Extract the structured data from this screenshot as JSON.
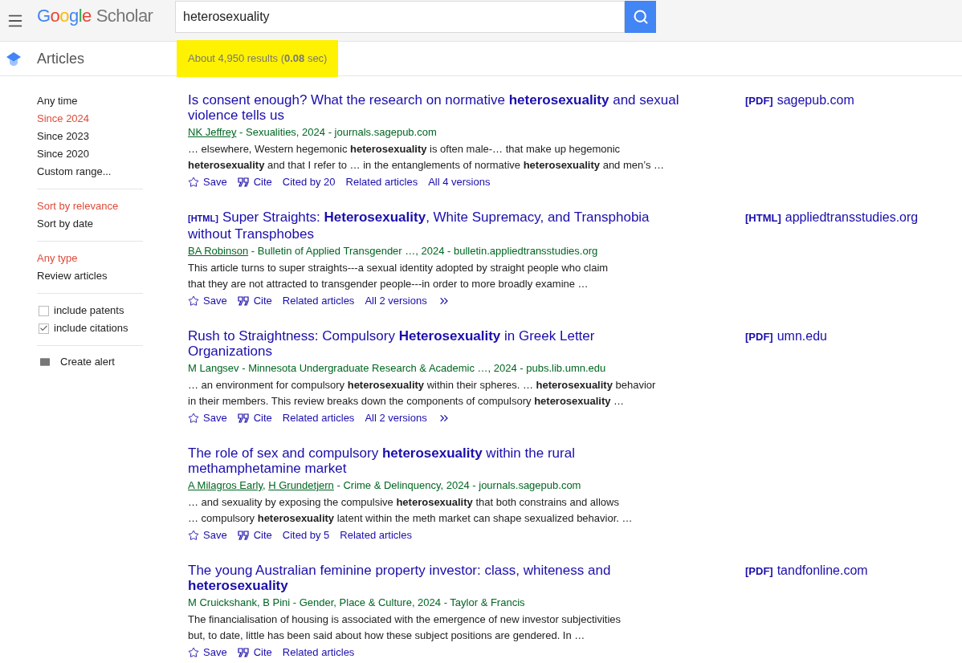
{
  "header": {
    "logo": {
      "brand": "Google",
      "product": "Scholar"
    },
    "search": {
      "value": "heterosexuality"
    }
  },
  "subheader": {
    "section": "Articles",
    "results_count": {
      "text": "About 4,950 results (**0.08** sec)",
      "highlighted": true
    }
  },
  "sidebar": {
    "groups": [
      {
        "items": [
          {
            "label": "Any time",
            "selected": false
          },
          {
            "label": "Since 2024",
            "selected": true
          },
          {
            "label": "Since 2023",
            "selected": false
          },
          {
            "label": "Since 2020",
            "selected": false
          },
          {
            "label": "Custom range...",
            "selected": false
          }
        ]
      },
      {
        "items": [
          {
            "label": "Sort by relevance",
            "selected": true
          },
          {
            "label": "Sort by date",
            "selected": false
          }
        ]
      },
      {
        "items": [
          {
            "label": "Any type",
            "selected": true
          },
          {
            "label": "Review articles",
            "selected": false
          }
        ]
      }
    ],
    "options": [
      {
        "label": "include patents",
        "checked": false
      },
      {
        "label": "include citations",
        "checked": true
      }
    ],
    "alert": "Create alert"
  },
  "results": [
    {
      "title": "Is consent enough? What the research on normative **heterosexuality** and sexual violence tells us",
      "byline": [
        {
          "kind": "link",
          "text": "NK Jeffrey"
        },
        {
          "kind": "text",
          "text": " - Sexualities, 2024 - journals.sagepub.com"
        }
      ],
      "snippet": [
        "… elsewhere, Western hegemonic **heterosexuality** is often male-… that make up hegemonic",
        "**heterosexuality** and that I refer to … in the entanglements of normative **heterosexuality** and men’s …"
      ],
      "actions": [
        {
          "kind": "save",
          "label": "Save"
        },
        {
          "kind": "cite",
          "label": "Cite"
        },
        {
          "kind": "link",
          "label": "Cited by 20"
        },
        {
          "kind": "link",
          "label": "Related articles"
        },
        {
          "kind": "link",
          "label": "All 4 versions"
        }
      ],
      "side_link": {
        "tag": "[PDF]",
        "domain": "sagepub.com"
      }
    },
    {
      "format": "[HTML]",
      "title": "Super Straights: **Heterosexuality**, White Supremacy, and Transphobia without Transphobes",
      "byline": [
        {
          "kind": "link",
          "text": "BA Robinson"
        },
        {
          "kind": "text",
          "text": " - Bulletin of Applied Transgender …, 2024 - bulletin.appliedtransstudies.org"
        }
      ],
      "snippet": [
        "This article turns to super straights---a sexual identity adopted by straight people who claim",
        "that they are not attracted to transgender people---in order to more broadly examine …"
      ],
      "actions": [
        {
          "kind": "save",
          "label": "Save"
        },
        {
          "kind": "cite",
          "label": "Cite"
        },
        {
          "kind": "link",
          "label": "Related articles"
        },
        {
          "kind": "link",
          "label": "All 2 versions"
        },
        {
          "kind": "more"
        }
      ],
      "side_link": {
        "tag": "[HTML]",
        "domain": "appliedtransstudies.org"
      }
    },
    {
      "title": "Rush to Straightness: Compulsory **Heterosexuality** in Greek Letter Organizations",
      "byline": [
        {
          "kind": "text",
          "text": "M Langsev - Minnesota Undergraduate Research & Academic …, 2024 - pubs.lib.umn.edu"
        }
      ],
      "snippet": [
        "… an environment for compulsory **heterosexuality** within their spheres. … **heterosexuality** behavior",
        "in their members. This review breaks down the components of compulsory **heterosexuality** …"
      ],
      "actions": [
        {
          "kind": "save",
          "label": "Save"
        },
        {
          "kind": "cite",
          "label": "Cite"
        },
        {
          "kind": "link",
          "label": "Related articles"
        },
        {
          "kind": "link",
          "label": "All 2 versions"
        },
        {
          "kind": "more"
        }
      ],
      "side_link": {
        "tag": "[PDF]",
        "domain": "umn.edu"
      }
    },
    {
      "title": "The role of sex and compulsory **heterosexuality** within the rural methamphetamine market",
      "byline": [
        {
          "kind": "link",
          "text": "A Milagros Early"
        },
        {
          "kind": "text",
          "text": ", "
        },
        {
          "kind": "link",
          "text": "H Grundetjern"
        },
        {
          "kind": "text",
          "text": " - Crime & Delinquency, 2024 - journals.sagepub.com"
        }
      ],
      "snippet": [
        "… and sexuality by exposing the compulsive **heterosexuality** that both constrains and allows",
        "… compulsory **heterosexuality** latent within the meth market can shape sexualized behavior. …"
      ],
      "actions": [
        {
          "kind": "save",
          "label": "Save"
        },
        {
          "kind": "cite",
          "label": "Cite"
        },
        {
          "kind": "link",
          "label": "Cited by 5"
        },
        {
          "kind": "link",
          "label": "Related articles"
        }
      ]
    },
    {
      "title": "The young Australian feminine property investor: class, whiteness and **heterosexuality**",
      "byline": [
        {
          "kind": "text",
          "text": "M Cruickshank, B Pini - Gender, Place & Culture, 2024 - Taylor & Francis"
        }
      ],
      "snippet": [
        "The financialisation of housing is associated with the emergence of new investor subjectivities",
        "but, to date, little has been said about how these subject positions are gendered. In …"
      ],
      "actions": [
        {
          "kind": "save",
          "label": "Save"
        },
        {
          "kind": "cite",
          "label": "Cite"
        },
        {
          "kind": "link",
          "label": "Related articles"
        }
      ],
      "side_link": {
        "tag": "[PDF]",
        "domain": "tandfonline.com"
      }
    }
  ]
}
